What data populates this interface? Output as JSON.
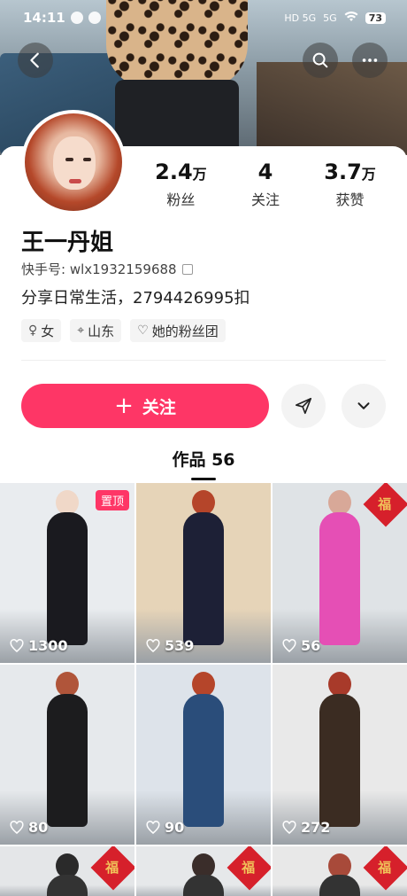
{
  "status_bar": {
    "time": "14:11",
    "network_a": "HD 5G",
    "network_b": "5G",
    "battery": "73"
  },
  "header": {
    "back_icon": "chevron-left-icon",
    "search_icon": "search-icon",
    "more_icon": "more-horizontal-icon"
  },
  "profile": {
    "name": "王一丹姐",
    "uid_label": "快手号: wlx1932159688",
    "bio": "分享日常生活，2794426995扣",
    "stats": [
      {
        "num": "2.4",
        "unit": "万",
        "label": "粉丝"
      },
      {
        "num": "4",
        "unit": "",
        "label": "关注"
      },
      {
        "num": "3.7",
        "unit": "万",
        "label": "获赞"
      }
    ],
    "tags": [
      {
        "icon": "female-icon",
        "glyph": "♀",
        "text": "女"
      },
      {
        "icon": "location-icon",
        "glyph": "⌖",
        "text": "山东"
      },
      {
        "icon": "fan-club-icon",
        "glyph": "♡",
        "text": "她的粉丝团"
      }
    ]
  },
  "actions": {
    "follow_label": "关注",
    "follow_plus": "+",
    "share_icon": "send-icon",
    "expand_icon": "chevron-down-icon"
  },
  "works": {
    "tab_label": "作品 56",
    "pinned_label": "置顶",
    "fu_text": "福",
    "items": [
      {
        "likes": "1300",
        "bg": "#e9ecef",
        "fig": "#1a1a1f",
        "head": "#f0d8c8",
        "pinned": true,
        "fu": false
      },
      {
        "likes": "539",
        "bg": "#e6d4b8",
        "fig": "#1d2036",
        "head": "#b5452a",
        "pinned": false,
        "fu": false
      },
      {
        "likes": "56",
        "bg": "#dfe3e6",
        "fig": "#e54fb5",
        "head": "#d8a898",
        "pinned": false,
        "fu": true
      },
      {
        "likes": "80",
        "bg": "#e6e9ec",
        "fig": "#1c1c1e",
        "head": "#b0553a",
        "pinned": false,
        "fu": false
      },
      {
        "likes": "90",
        "bg": "#dde3ea",
        "fig": "#2a4d7a",
        "head": "#b5452a",
        "pinned": false,
        "fu": false
      },
      {
        "likes": "272",
        "bg": "#e9e9e9",
        "fig": "#3b2c22",
        "head": "#a83a2a",
        "pinned": false,
        "fu": false
      },
      {
        "likes": "",
        "bg": "#e4e6e8",
        "fig": "#333",
        "head": "#2a2a2a",
        "pinned": false,
        "fu": true
      },
      {
        "likes": "",
        "bg": "#e6e8ea",
        "fig": "#333",
        "head": "#3a2d2a",
        "pinned": false,
        "fu": true
      },
      {
        "likes": "",
        "bg": "#e8e8e8",
        "fig": "#333",
        "head": "#a84a3a",
        "pinned": false,
        "fu": true
      }
    ]
  },
  "colors": {
    "accent": "#fe3666",
    "text": "#111111"
  }
}
